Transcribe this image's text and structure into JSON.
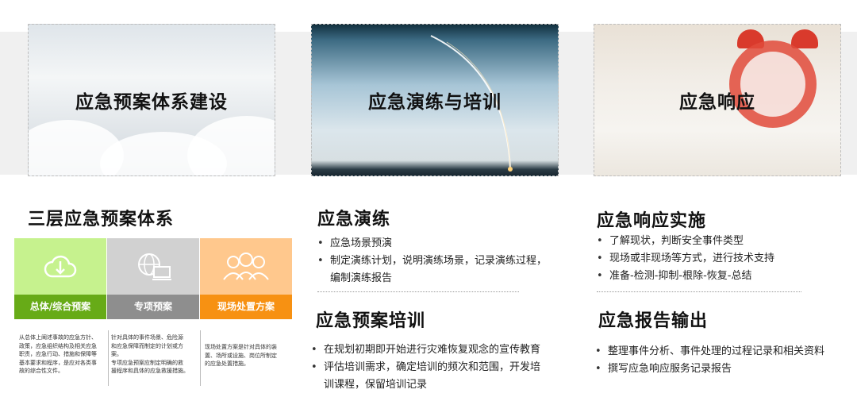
{
  "cards": [
    {
      "title": "应急预案体系建设"
    },
    {
      "title": "应急演练与培训"
    },
    {
      "title": "应急响应"
    }
  ],
  "left": {
    "title": "三层应急预案体系",
    "tiles": [
      {
        "label": "总体/综合预案",
        "icon": "cloud-download-icon"
      },
      {
        "label": "专项预案",
        "icon": "globe-monitor-icon"
      },
      {
        "label": "现场处置方案",
        "icon": "people-group-icon"
      }
    ],
    "descriptions": [
      [
        "从总体上阐述事故的应急方针、",
        "政策，应急组织结构及相关应急",
        "职责，应急行动、措施和保障等",
        "基本要求和程序，是应对各类事",
        "故的综合性文件。"
      ],
      [
        "针对具体的事件场景、危险源",
        "和应急保障而制定的计划或方",
        "案。",
        "专项应急预案应制定明确的救",
        "援程序和具体的应急救援措施。"
      ],
      [
        "现场处置方案是针对具体的装",
        "置、场所或设施、岗位所制定",
        "的应急处置措施。"
      ]
    ]
  },
  "middle": {
    "drill": {
      "title": "应急演练",
      "items": [
        "应急场景预演",
        "制定演练计划，说明演练场景，记录演练过程，",
        "编制演练报告"
      ]
    },
    "training": {
      "title": "应急预案培训",
      "items": [
        "在规划初期即开始进行灾难恢复观念的宣传教育",
        "评估培训需求，确定培训的频次和范围，开发培",
        "训课程，保留培训记录"
      ]
    }
  },
  "right": {
    "implement": {
      "title": "应急响应实施",
      "items": [
        "了解现状，判断安全事件类型",
        "现场或非现场等方式，进行技术支持",
        "准备-检测-抑制-根除-恢复-总结"
      ]
    },
    "report": {
      "title": "应急报告输出",
      "items": [
        "整理事件分析、事件处理的过程记录和相关资料",
        "撰写应急响应服务记录报告"
      ]
    }
  }
}
